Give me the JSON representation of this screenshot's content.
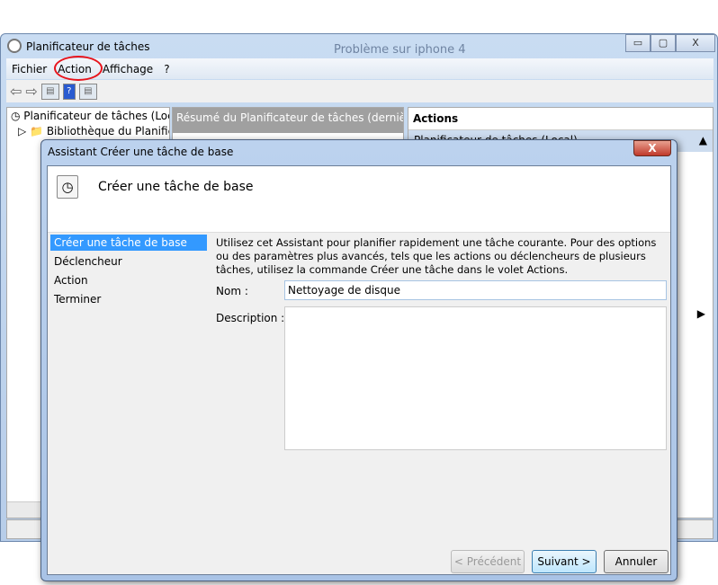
{
  "window": {
    "title": "Planificateur de tâches",
    "bg_text": "Problème sur iphone 4",
    "minimize": "▭",
    "maximize": "▢",
    "close": "X"
  },
  "menu": [
    "Fichier",
    "Action",
    "Affichage",
    "?"
  ],
  "annotation_color": "#e8141c",
  "tree": {
    "root": "Planificateur de tâches (Local)",
    "child": "Bibliothèque du Planificateur de tâches"
  },
  "middle": {
    "header": "Résumé du Planificateur de tâches (dernière réa"
  },
  "actions": {
    "header": "Actions",
    "section": "Planificateur de tâches (Local)"
  },
  "dialog": {
    "title": "Assistant Créer une tâche de base",
    "close": "X",
    "heading": "Créer une tâche de base",
    "nav": [
      "Créer une tâche de base",
      "Déclencheur",
      "Action",
      "Terminer"
    ],
    "intro": "Utilisez cet Assistant pour planifier rapidement une tâche courante. Pour des options ou des paramètres plus avancés, tels que les actions ou déclencheurs de plusieurs tâches, utilisez la commande Créer une tâche dans le volet Actions.",
    "name_label": "Nom :",
    "name_value": "Nettoyage de disque",
    "desc_label": "Description :",
    "desc_value": "",
    "prev": "< Précédent",
    "next": "Suivant >",
    "cancel": "Annuler"
  }
}
